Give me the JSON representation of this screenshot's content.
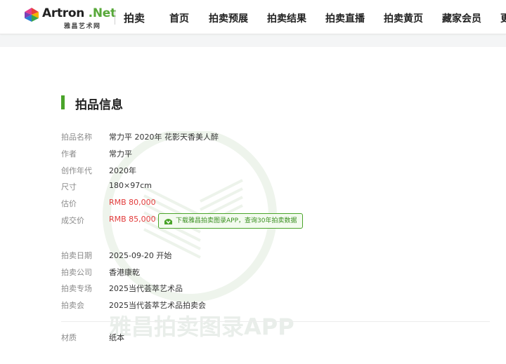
{
  "header": {
    "logo_text": "Artron",
    "logo_net": ".Net",
    "logo_sub": "雅昌艺术网",
    "section": "拍卖",
    "nav": [
      "首页",
      "拍卖预展",
      "拍卖结果",
      "拍卖直播",
      "拍卖黄页",
      "藏家会员",
      "更"
    ]
  },
  "section_title": "拍品信息",
  "watermark_text": "雅昌拍卖图录APP",
  "details": {
    "name": {
      "label": "拍品名称",
      "value": "常力平 2020年 花影天香美人醉"
    },
    "author": {
      "label": "作者",
      "value": "常力平"
    },
    "year": {
      "label": "创作年代",
      "value": "2020年"
    },
    "size": {
      "label": "尺寸",
      "value": "180×97cm"
    },
    "estimate": {
      "label": "估价",
      "value": "RMB 80,000"
    },
    "deal": {
      "label": "成交价",
      "value": "RMB 85,000"
    },
    "date": {
      "label": "拍卖日期",
      "value": "2025-09-20 开始"
    },
    "company": {
      "label": "拍卖公司",
      "value": "香港康乾"
    },
    "session": {
      "label": "拍卖专场",
      "value": "2025当代荟萃艺术品"
    },
    "auction": {
      "label": "拍卖会",
      "value": "2025当代荟萃艺术品拍卖会"
    },
    "material": {
      "label": "材质",
      "value": "纸本"
    }
  },
  "app_promo": "下载雅昌拍卖图录APP，查询30年拍卖数据",
  "colors": {
    "accent": "#4aa42a",
    "price": "#e23b3b"
  }
}
